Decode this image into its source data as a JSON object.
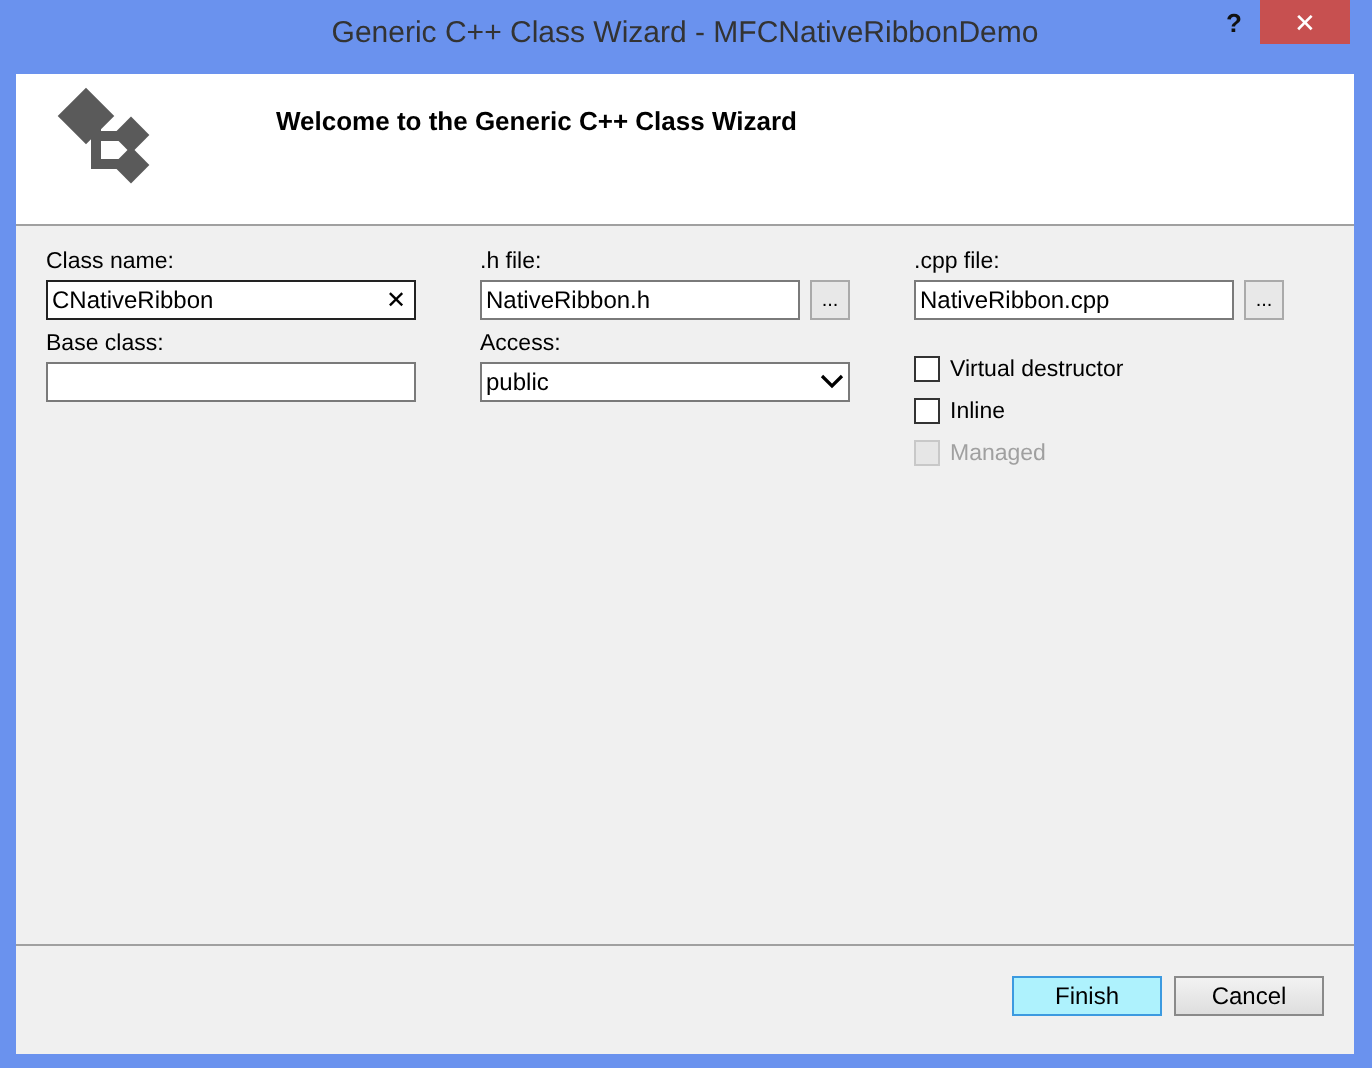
{
  "window": {
    "title": "Generic C++ Class Wizard - MFCNativeRibbonDemo",
    "help": "?",
    "close": "✕"
  },
  "header": {
    "title": "Welcome to the Generic C++ Class Wizard"
  },
  "fields": [
    {
      "kind": "text",
      "label": "Class name:",
      "value": "CNativeRibbon",
      "clear": "✕"
    },
    {
      "kind": "text",
      "label": ".h file:",
      "value": "NativeRibbon.h",
      "browse": "..."
    },
    {
      "kind": "text",
      "label": ".cpp file:",
      "value": "NativeRibbon.cpp",
      "browse": "..."
    },
    {
      "kind": "text",
      "label": "Base class:"
    },
    {
      "kind": "select",
      "label": "Access:",
      "value": "public"
    }
  ],
  "options": [
    {
      "label": "Virtual destructor",
      "checked": false,
      "disabled": false
    },
    {
      "label": "Inline",
      "checked": false,
      "disabled": false
    },
    {
      "label": "Managed",
      "checked": false,
      "disabled": true
    }
  ],
  "buttons": [
    {
      "label": "Finish",
      "default": true
    },
    {
      "label": "Cancel",
      "default": false
    }
  ]
}
